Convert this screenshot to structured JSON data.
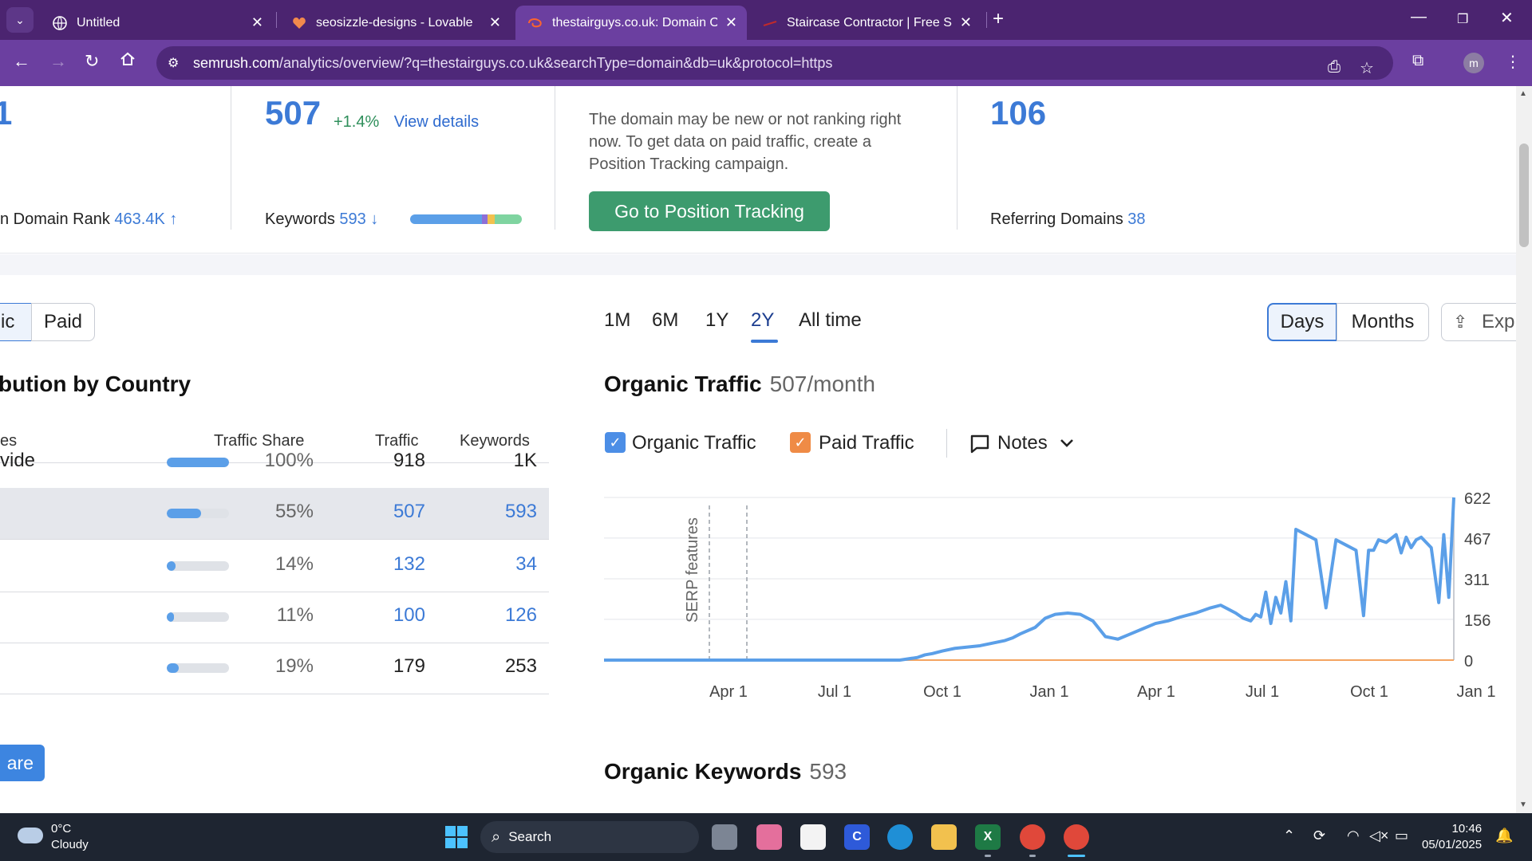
{
  "browser": {
    "tabs": [
      {
        "title": "Untitled",
        "icon": "globe-icon",
        "active": false
      },
      {
        "title": "seosizzle-designs - Lovable",
        "icon": "heart-icon",
        "active": false
      },
      {
        "title": "thestairguys.co.uk: Domain Ove",
        "icon": "semrush-icon",
        "active": true
      },
      {
        "title": "Staircase Contractor | Free Site",
        "icon": "site-icon",
        "active": false
      }
    ],
    "url_host": "semrush.com",
    "url_path": "/analytics/overview/?q=thestairguys.co.uk&searchType=domain&db=uk&protocol=https",
    "profile_initial": "m"
  },
  "summary": {
    "col1_value": "1",
    "col1_label": "n Domain Rank",
    "col1_rank": "463.4K ↑",
    "traffic_value": "507",
    "traffic_change": "+1.4%",
    "view_details": "View details",
    "keywords_label": "Keywords",
    "keywords_value": "593 ↓",
    "keywords_bar": [
      0.64,
      0.05,
      0.07,
      0.24
    ],
    "paid_empty_text": "The domain may be new or not ranking right now. To get data on paid traffic, create a Position Tracking campaign.",
    "position_tracking_button": "Go to Position Tracking",
    "backlinks_value": "106",
    "ref_domains_label": "Referring Domains",
    "ref_domains_value": "38"
  },
  "left": {
    "seg_organic": "ic",
    "seg_paid": "Paid",
    "title": "bution by Country",
    "headers": {
      "country": "es",
      "share": "Traffic Share",
      "traffic": "Traffic",
      "keywords": "Keywords"
    },
    "rows": [
      {
        "country": "vide",
        "share": "100%",
        "share_frac": 1.0,
        "traffic": "918",
        "keywords": "1K",
        "linked": false,
        "highlight": false
      },
      {
        "country": "",
        "share": "55%",
        "share_frac": 0.55,
        "traffic": "507",
        "keywords": "593",
        "linked": true,
        "highlight": true
      },
      {
        "country": "",
        "share": "14%",
        "share_frac": 0.14,
        "traffic": "132",
        "keywords": "34",
        "linked": true,
        "highlight": false
      },
      {
        "country": "",
        "share": "11%",
        "share_frac": 0.11,
        "traffic": "100",
        "keywords": "126",
        "linked": true,
        "highlight": false
      },
      {
        "country": "",
        "share": "19%",
        "share_frac": 0.19,
        "traffic": "179",
        "keywords": "253",
        "linked": false,
        "highlight": false
      }
    ],
    "compare_button": "are"
  },
  "right": {
    "periods": [
      "1M",
      "6M",
      "1Y",
      "2Y",
      "All time"
    ],
    "selected_period": "2Y",
    "days": "Days",
    "months": "Months",
    "export": "Exp",
    "title": "Organic Traffic",
    "title_sub": "507/month",
    "legend_organic": "Organic Traffic",
    "legend_paid": "Paid Traffic",
    "notes": "Notes",
    "keywords_title": "Organic Keywords",
    "keywords_sub": "593"
  },
  "chart_data": {
    "type": "line",
    "ylim": [
      0,
      622
    ],
    "y_ticks": [
      "622",
      "467",
      "311",
      "156",
      "0"
    ],
    "x_tick_labels": [
      "Apr 1",
      "Jul 1",
      "Oct 1",
      "Jan 1",
      "Apr 1",
      "Jul 1",
      "Oct 1",
      "Jan 1"
    ],
    "annotation": "SERP features",
    "series": [
      {
        "name": "Organic Traffic",
        "color": "#5b9fe8",
        "x": [
          0,
          70,
          105,
          118,
          125,
          128,
          131,
          135,
          140,
          145,
          150,
          155,
          160,
          163,
          166,
          172,
          176,
          180,
          185,
          190,
          195,
          200,
          205,
          210,
          215,
          220,
          225,
          230,
          236,
          242,
          246,
          252,
          255,
          258,
          260,
          262,
          264,
          266,
          268,
          270,
          272,
          274,
          276,
          280,
          284,
          288,
          292,
          296,
          300,
          303,
          305,
          307,
          309,
          312,
          316,
          318,
          320,
          322,
          324,
          326,
          330,
          333,
          335,
          337,
          339
        ],
        "y": [
          0,
          0,
          0,
          0,
          10,
          20,
          25,
          35,
          45,
          50,
          55,
          65,
          75,
          85,
          100,
          125,
          160,
          175,
          180,
          175,
          150,
          90,
          80,
          100,
          120,
          140,
          150,
          165,
          180,
          200,
          210,
          180,
          160,
          150,
          175,
          165,
          260,
          140,
          240,
          180,
          300,
          150,
          500,
          480,
          460,
          200,
          460,
          440,
          420,
          170,
          420,
          420,
          460,
          450,
          480,
          410,
          470,
          430,
          460,
          470,
          430,
          220,
          480,
          240,
          622
        ]
      },
      {
        "name": "Paid Traffic",
        "color": "#f4a460",
        "x": [
          0,
          339
        ],
        "y": [
          0,
          0
        ]
      }
    ]
  },
  "taskbar": {
    "temp": "0°C",
    "condition": "Cloudy",
    "search": "Search",
    "time": "10:46",
    "date": "05/01/2025"
  }
}
